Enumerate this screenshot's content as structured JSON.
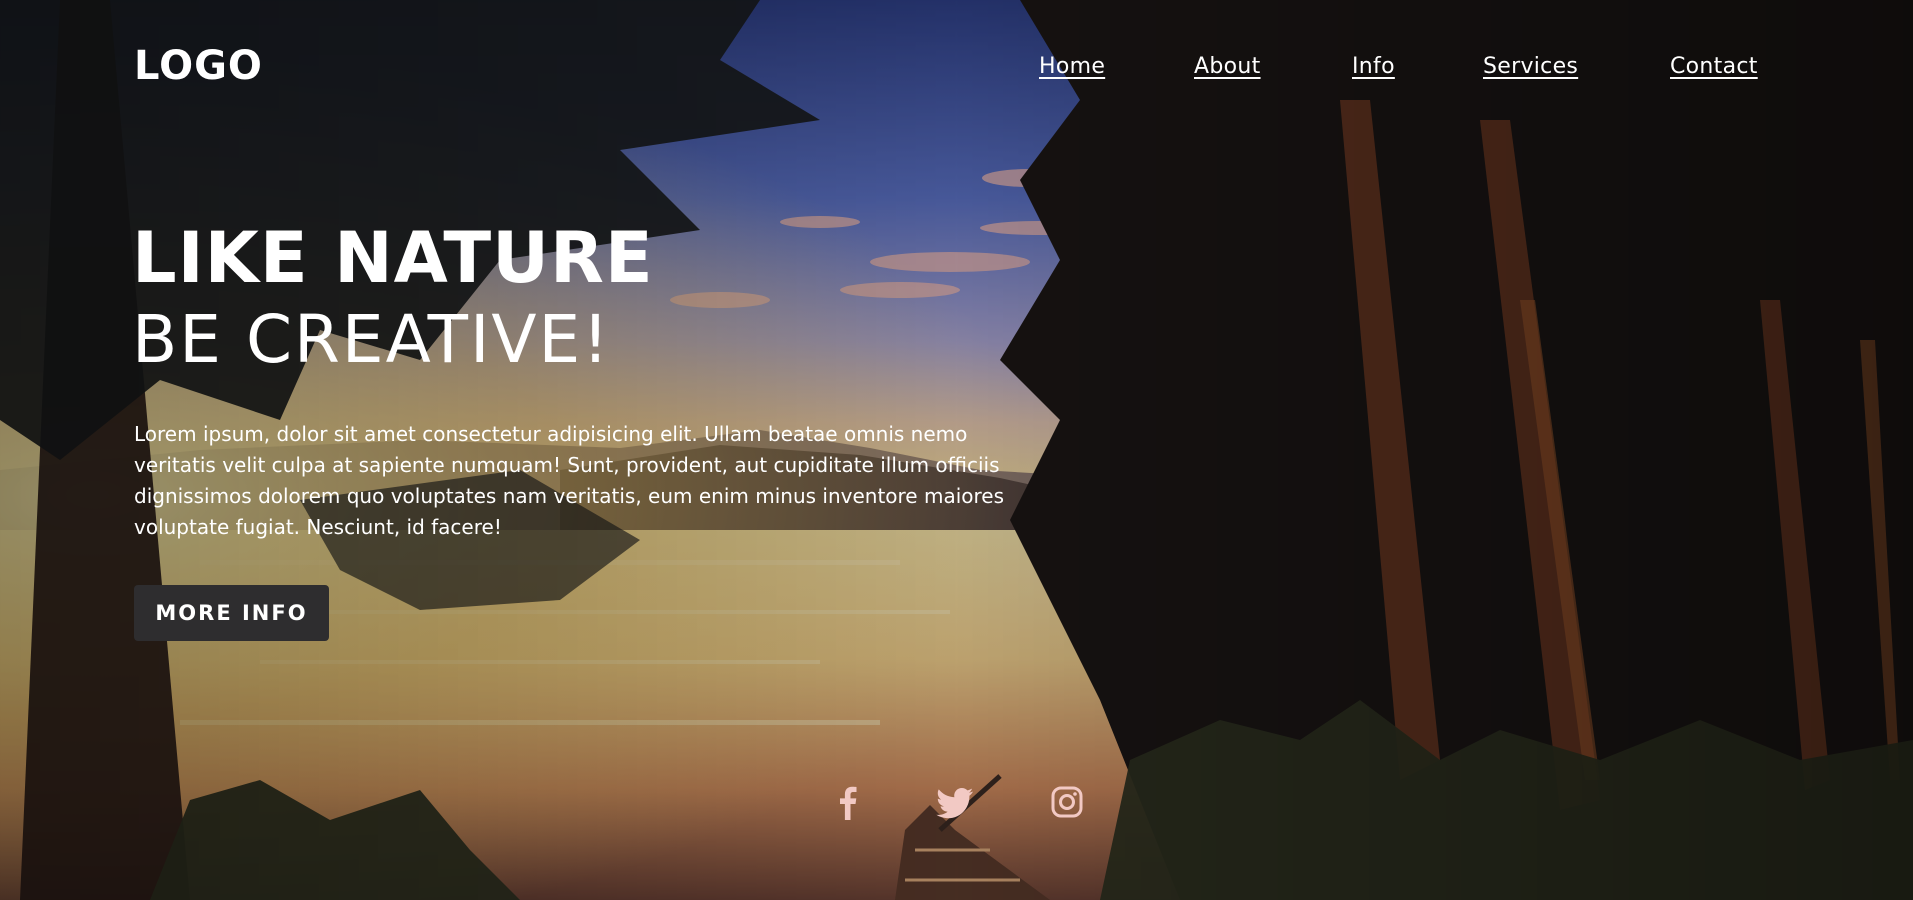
{
  "header": {
    "logo": "LOGO",
    "nav": [
      "Home",
      "About",
      "Info",
      "Services",
      "Contact"
    ]
  },
  "hero": {
    "title_line1": "LIKE NATURE",
    "title_line2": "BE CREATIVE!",
    "body": "Lorem ipsum, dolor sit amet consectetur adipisicing elit. Ullam beatae omnis nemo veritatis velit culpa at sapiente numquam! Sunt, provident, aut cupiditate illum officiis dignissimos dolorem quo voluptates nam veritatis, eum enim minus inventore maiores voluptate fugiat. Nesciunt, id facere!",
    "button_label": "MORE INFO"
  },
  "social": {
    "icons": [
      "facebook-icon",
      "twitter-icon",
      "instagram-icon"
    ]
  },
  "colors": {
    "text": "#ffffff",
    "button_bg": "#2e2d2f",
    "social_icon": "#f2c9c4"
  }
}
